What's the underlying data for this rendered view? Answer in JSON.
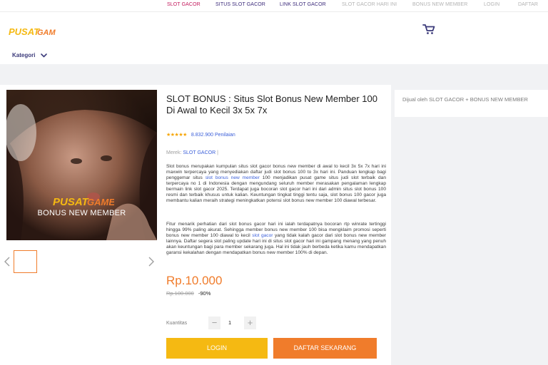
{
  "topnav": [
    {
      "label": "SLOT GACOR"
    },
    {
      "label": "SITUS SLOT GACOR"
    },
    {
      "label": "LINK SLOT GACOR"
    },
    {
      "label": "SLOT GACOR HARI INI"
    },
    {
      "label": "BONUS NEW MEMBER"
    },
    {
      "label": "LOGIN"
    },
    {
      "label": "DAFTAR"
    }
  ],
  "header": {
    "logo_text": "PUSATGAME",
    "kategori_label": "Kategori",
    "cart_icon": "cart-icon"
  },
  "product": {
    "title": "SLOT BONUS : Situs Slot Bonus New Member 100 Di Awal to Kecil 3x 5x 7x",
    "stars": "★★★★★",
    "rating_count": "8.832.900 Penilaian",
    "brand_label": "Merek:",
    "brand_value": "SLOT GACOR",
    "brand_sep": "|",
    "image_logo": "PUSATGAME",
    "image_caption": "BONUS NEW MEMBER",
    "desc1_a": "Slot bonus merupakan kumpulan situs slot gacor bonus new member di awal to kecil 3x 5x 7x hari ini maxwin terpercaya yang menyediakan daftar judi slot bonus 100 to 3x hari ini. Panduan lengkap bagi penggemar situs ",
    "desc1_link": "slot bonus new member",
    "desc1_b": " 100 menjadikan pusat game situs judi slot terbaik dan terpercaya no 1 di Indonesia dengan mengundang seluruh member merasakan pengalaman lengkap bermain link slot gacor 2025. Terdapat juga bocoran slot gacor hari ini dari admin situs slot bonus 100 resmi dan terbaik khusus untuk kalian. Keuntungan tingkat tinggi tentu saja, slot bonus 100 gacor juga membantu kalian meraih strategi meningkatkan potensi slot bonus new member 100 diawal terbesar.",
    "desc2_a": "Fitur menarik perhatian dari slot bonus gacor hari ini ialah terdapatnya bocoran rtp winrate tertinggi hingga 99% paling akurat. Sehingga member bonus new member 100 bisa mengklaim promosi seperti bonus new member 100 diawal to kecil ",
    "desc2_link": "slot gacor",
    "desc2_b": " yang tidak kalah gacor dari slot bonus new member lainnya. Daftar segera slot paling update hari ini di situs slot gacor hari ini gampang menang yang penuh akan keuntungan bagi para member sekarang juga. Hal ini tidak jauh berbeda ketika kamu mendapatkan garansi kekalahan dengan mendapatkan bonus new member 100% di depan.",
    "price": "Rp.10.000",
    "old_price": "Rp.100.000",
    "discount": "-90%",
    "qty_label": "Kuantitas",
    "qty_minus": "−",
    "qty_value": "1",
    "qty_plus": "+",
    "login_label": "LOGIN",
    "daftar_label": "DAFTAR SEKARANG"
  },
  "seller": {
    "text": "Dijual oleh SLOT GACOR + BONUS NEW MEMBER"
  },
  "colors": {
    "accent_orange": "#f07c2b",
    "accent_yellow": "#f5b912",
    "link_blue": "#3b5fd9",
    "nav_active": "#c2185b"
  }
}
